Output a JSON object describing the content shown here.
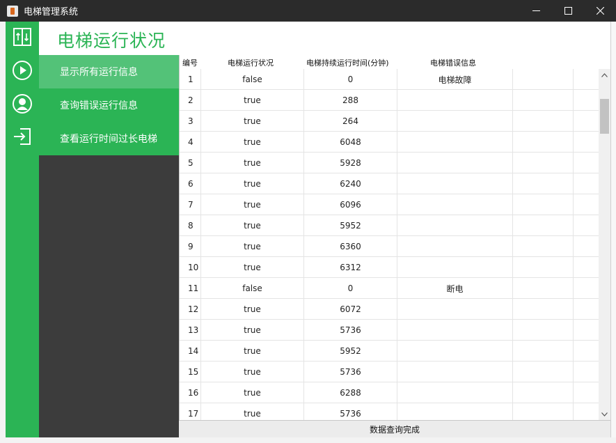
{
  "window": {
    "title": "电梯管理系统",
    "minimize_glyph": "—",
    "maximize_glyph": "☐",
    "close_glyph": "✕"
  },
  "colors": {
    "accent": "#2bb455",
    "active_menu": "#53c278",
    "menu_dark": "#3c3c3c",
    "titlebar": "#2b2b2b"
  },
  "rail_icons": [
    "elevator-icon",
    "play-icon",
    "user-icon",
    "logout-icon"
  ],
  "header": {
    "title": "电梯运行状况"
  },
  "menu": {
    "items": [
      {
        "label": "显示所有运行信息",
        "active": true
      },
      {
        "label": "查询错误运行信息",
        "active": false
      },
      {
        "label": "查看运行时间过长电梯",
        "active": false
      }
    ]
  },
  "table": {
    "columns": [
      "编号",
      "电梯运行状况",
      "电梯持续运行时间(分钟)",
      "电梯错误信息"
    ],
    "rows": [
      [
        "1",
        "false",
        "0",
        "电梯故障"
      ],
      [
        "2",
        "true",
        "288",
        ""
      ],
      [
        "3",
        "true",
        "264",
        ""
      ],
      [
        "4",
        "true",
        "6048",
        ""
      ],
      [
        "5",
        "true",
        "5928",
        ""
      ],
      [
        "6",
        "true",
        "6240",
        ""
      ],
      [
        "7",
        "true",
        "6096",
        ""
      ],
      [
        "8",
        "true",
        "5952",
        ""
      ],
      [
        "9",
        "true",
        "6360",
        ""
      ],
      [
        "10",
        "true",
        "6312",
        ""
      ],
      [
        "11",
        "false",
        "0",
        "断电"
      ],
      [
        "12",
        "true",
        "6072",
        ""
      ],
      [
        "13",
        "true",
        "5736",
        ""
      ],
      [
        "14",
        "true",
        "5952",
        ""
      ],
      [
        "15",
        "true",
        "5736",
        ""
      ],
      [
        "16",
        "true",
        "6288",
        ""
      ],
      [
        "17",
        "true",
        "5736",
        ""
      ]
    ]
  },
  "status": {
    "text": "数据查询完成"
  }
}
